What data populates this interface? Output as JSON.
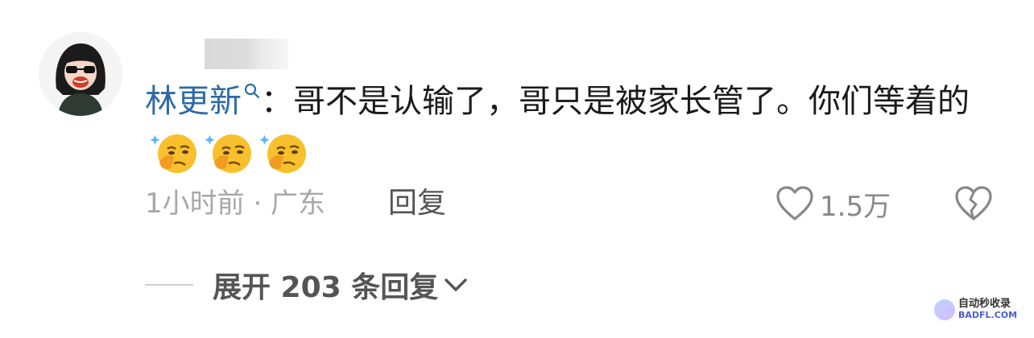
{
  "comment": {
    "username": "林更新",
    "separator": "：",
    "text": "哥不是认输了，哥只是被家长管了。你们等着的",
    "emojis": [
      "thinking-smirk-emoji",
      "thinking-smirk-emoji",
      "thinking-smirk-emoji"
    ]
  },
  "meta": {
    "time_location": "1小时前 · 广东",
    "reply_label": "回复"
  },
  "actions": {
    "like_count": "1.5万",
    "like_icon": "heart-outline-icon",
    "dislike_icon": "broken-heart-icon"
  },
  "expand": {
    "label": "展开 203 条回复",
    "icon": "chevron-down-icon"
  },
  "watermark": {
    "line1": "自动秒收录",
    "line2": "BADFL.COM"
  },
  "colors": {
    "username": "#2d6aa7",
    "text": "#1a1a1a",
    "meta": "#a8a8a8",
    "reply": "#555555"
  }
}
